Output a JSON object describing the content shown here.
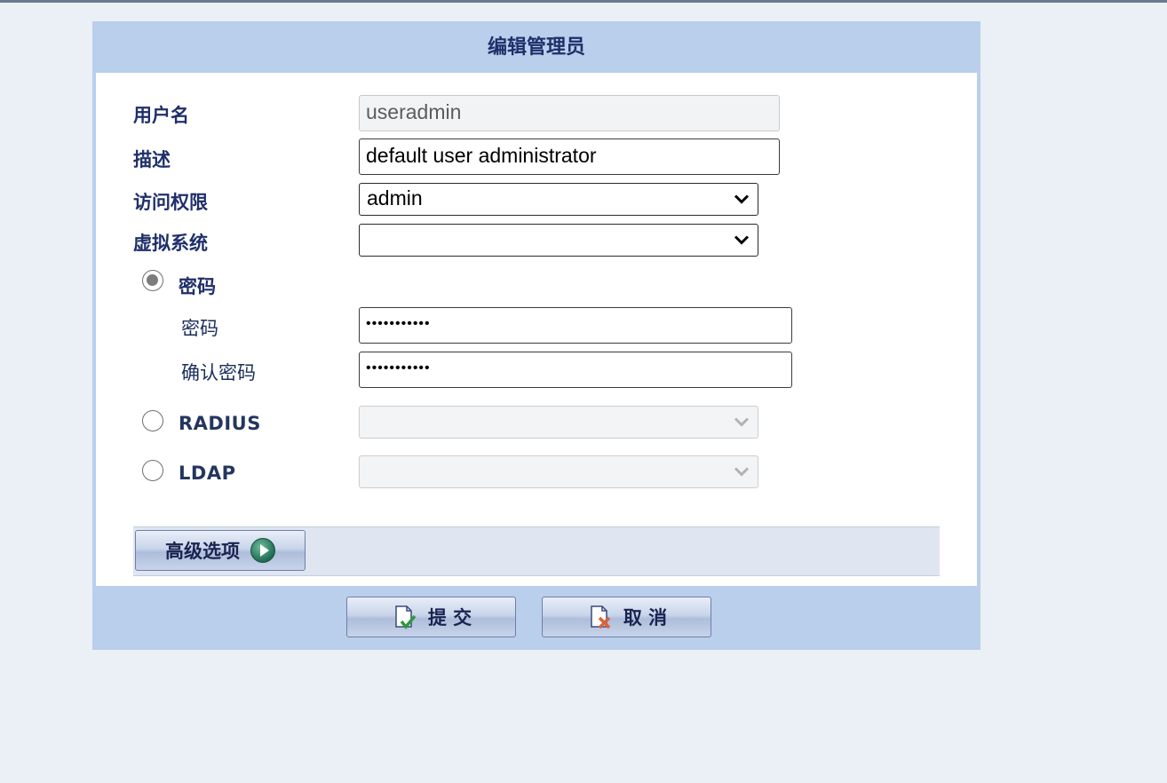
{
  "dialog": {
    "title": "编辑管理员"
  },
  "form": {
    "username": {
      "label": "用户名",
      "value": "useradmin",
      "readonly": true
    },
    "description": {
      "label": "描述",
      "value": "default user administrator"
    },
    "access": {
      "label": "访问权限",
      "selected": "admin"
    },
    "vsys": {
      "label": "虚拟系统",
      "selected": ""
    },
    "auth_password": {
      "label": "密码",
      "checked": true,
      "password": {
        "label": "密码",
        "value": "•••••••••••"
      },
      "confirm": {
        "label": "确认密码",
        "value": "•••••••••••"
      }
    },
    "auth_radius": {
      "label": "RADIUS",
      "checked": false,
      "selected": ""
    },
    "auth_ldap": {
      "label": "LDAP",
      "checked": false,
      "selected": ""
    }
  },
  "advanced_button": {
    "label": "高级选项",
    "icon": "play-circle-icon"
  },
  "footer": {
    "submit": {
      "label": "提 交",
      "icon": "document-check-icon"
    },
    "cancel": {
      "label": "取 消",
      "icon": "document-cancel-icon"
    }
  },
  "colors": {
    "page_bg": "#eaf0f5",
    "dialog_frame": "#b9cfeb",
    "label_text": "#1f2f6a"
  }
}
